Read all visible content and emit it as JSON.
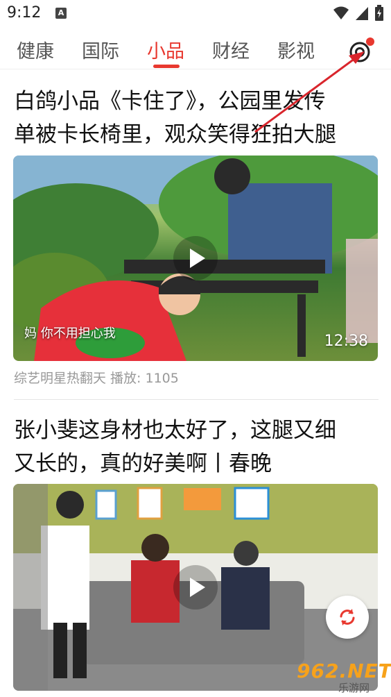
{
  "status_bar": {
    "time": "9:12",
    "notification_badge": "A"
  },
  "tabs": {
    "items": [
      {
        "label": "健康",
        "active": false
      },
      {
        "label": "国际",
        "active": false
      },
      {
        "label": "小品",
        "active": true
      },
      {
        "label": "财经",
        "active": false
      },
      {
        "label": "影视",
        "active": false
      }
    ],
    "settings_icon": "settings-eye-icon",
    "accent_color": "#e8382f"
  },
  "articles": [
    {
      "title_line1": "白鸽小品《卡住了》，公园里发传",
      "title_line2": "单被卡长椅里，观众笑得狂拍大腿",
      "video_subtitle": "妈 你不用担心我",
      "duration": "12:38",
      "meta": "综艺明星热翻天 播放: 1105"
    },
    {
      "title_line1": "张小斐这身材也太好了，这腿又细",
      "title_line2": "又长的，真的好美啊丨春晚"
    }
  ],
  "watermark": {
    "main": "962.NET",
    "sub": "乐游网"
  }
}
